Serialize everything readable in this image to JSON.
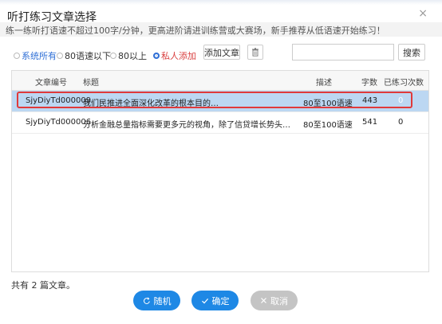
{
  "dialog": {
    "title": "听打练习文章选择",
    "close_symbol": "×",
    "tip": "练一练听打语速不超过100字/分钟，更高进阶请进训练营或大赛场，新手推荐从低语速开始练习！"
  },
  "filters": {
    "options": [
      {
        "label": "系统所有",
        "selected": false
      },
      {
        "label": "80语速以下",
        "selected": false
      },
      {
        "label": "80以上",
        "selected": false
      },
      {
        "label": "私人添加",
        "selected": true
      }
    ],
    "add_label": "添加文章",
    "search_value": "",
    "search_label": "搜索"
  },
  "table": {
    "columns": [
      "文章编号",
      "标题",
      "描述",
      "字数",
      "已练习次数"
    ],
    "rows": [
      {
        "id": "SjyDiyTd000009",
        "title": "我们民推进全面深化改革的根本目的…",
        "desc": "80至100语速",
        "words": "443",
        "practiced": "0",
        "selected": true
      },
      {
        "id": "SjyDiyTd000006",
        "title": "分析金融总量指标需要更多元的视角，除了信贷增长势头…",
        "desc": "80至100语速",
        "words": "541",
        "practiced": "0",
        "selected": false
      }
    ]
  },
  "footer": {
    "count_text": "共有 2 篇文章。",
    "random_label": "随机",
    "confirm_label": "确定",
    "cancel_label": "取消"
  },
  "icons": {
    "radio": "radio-icon",
    "trash": "trash-icon",
    "refresh": "refresh-icon",
    "check": "check-icon",
    "close": "close-icon"
  },
  "colors": {
    "accent": "#1e88e5",
    "selected_row": "#bcd7f2",
    "highlight": "#e03a3a",
    "private_option": "#d94040"
  }
}
